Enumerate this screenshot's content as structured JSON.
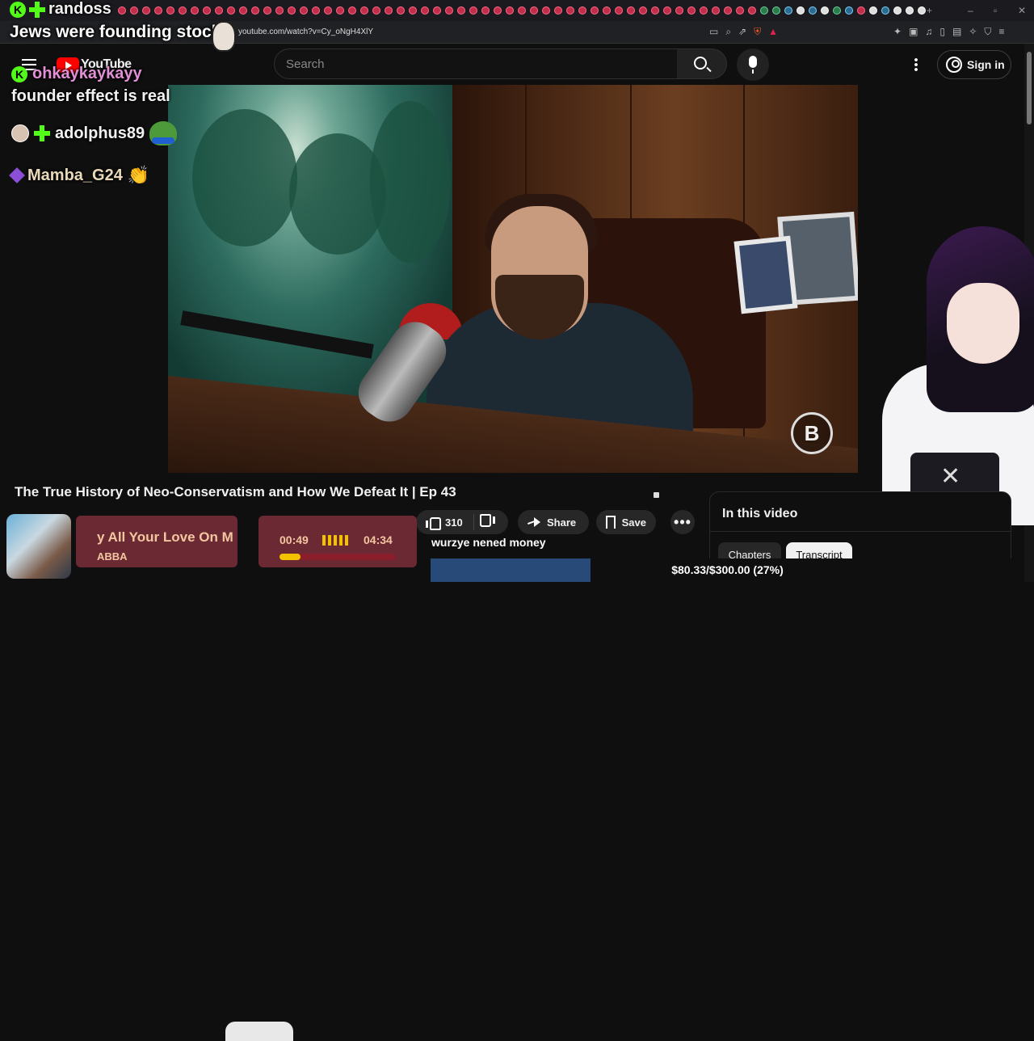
{
  "browser": {
    "url": "youtube.com/watch?v=Cy_oNgH4XlY",
    "new_tab_label": "+"
  },
  "youtube": {
    "logo_text": "YouTube",
    "search_placeholder": "Search",
    "signin_label": "Sign in"
  },
  "video": {
    "title": "The True History of Neo-Conservatism and How We Defeat It | Ep 43",
    "likes": "310",
    "share_label": "Share",
    "save_label": "Save",
    "more_label": "•••"
  },
  "side_panel": {
    "title": "In this video",
    "chips": [
      "Chapters",
      "Transcript"
    ],
    "active_chip": "Transcript"
  },
  "overlay_chat": {
    "top_user": "randoss",
    "top_message": "Jews were founding stock",
    "user2": "ohkaykaykayy",
    "message2": "founder effect is real",
    "user3": "adolphus89",
    "user4": "Mamba_G24"
  },
  "music_widget": {
    "song": "y All Your Love On M",
    "artist": "ABBA",
    "elapsed": "00:49",
    "duration": "04:34",
    "progress_fraction": 0.18
  },
  "stream_overlay": {
    "snippet_text": "wurzye nened money",
    "goal_text": "$80.33/$300.00 (27%)",
    "goal_fraction": 0.27,
    "kick_badge": "K",
    "rumble_glyph": "B"
  },
  "colors": {
    "youtube_red": "#ff0000",
    "kick_green": "#53fc18",
    "music_card": "#6b2a33",
    "goal_bar": "#274a78"
  }
}
